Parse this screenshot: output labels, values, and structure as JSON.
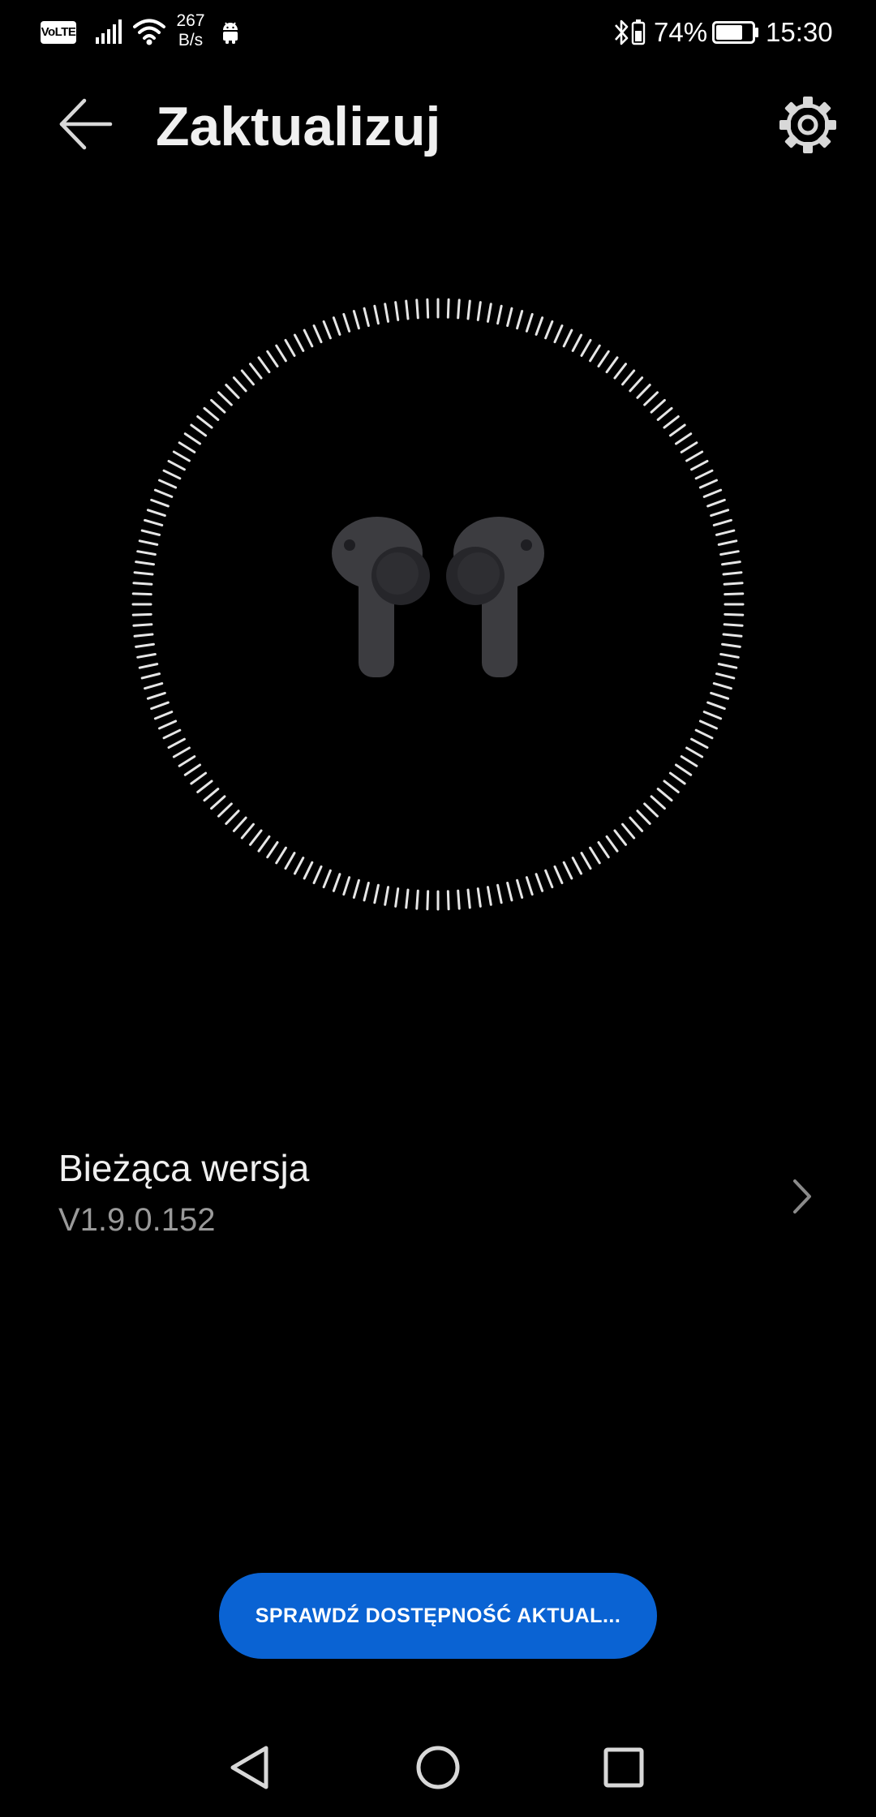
{
  "status_bar": {
    "volte": "VoLTE",
    "net_speed_value": "267",
    "net_speed_unit": "B/s",
    "battery_percent": "74%",
    "battery_level": 0.74,
    "time": "15:30"
  },
  "header": {
    "title": "Zaktualizuj",
    "back_icon": "arrow-left-icon",
    "settings_icon": "gear-icon"
  },
  "device": {
    "image": "earbuds-icon"
  },
  "current_version": {
    "label": "Bieżąca wersja",
    "value": "V1.9.0.152"
  },
  "actions": {
    "check_update_label": "SPRAWDŹ DOSTĘPNOŚĆ AKTUAL..."
  },
  "colors": {
    "background": "#000000",
    "accent": "#0a63d3",
    "text_primary": "#f0f0f0",
    "text_secondary": "#9a9a9a",
    "earbud": "#3c3c40"
  }
}
